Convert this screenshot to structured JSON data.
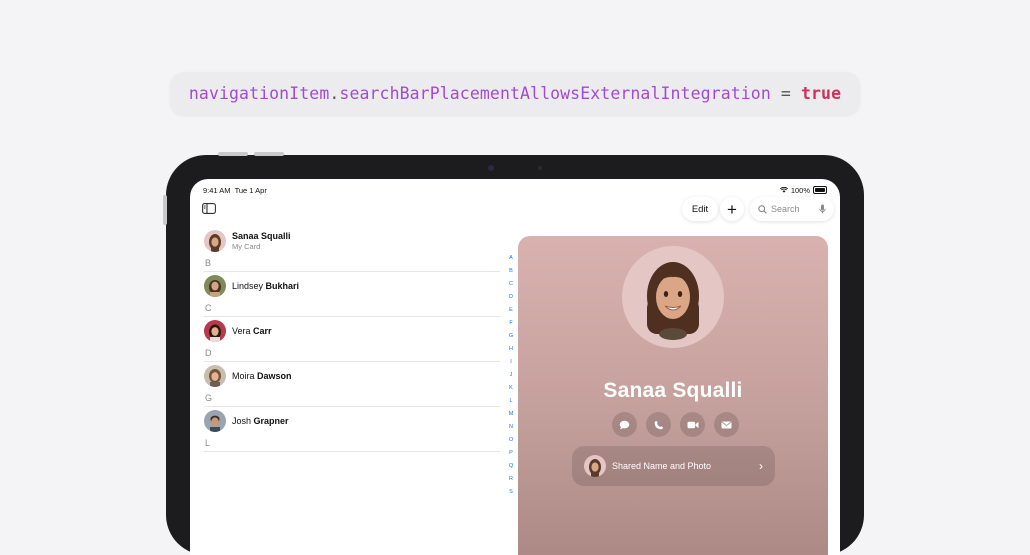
{
  "code": {
    "receiver": "navigationItem",
    "dot": ".",
    "property": "searchBarPlacementAllowsExternalIntegration",
    "operator": " = ",
    "value": "true"
  },
  "status": {
    "time": "9:41 AM",
    "date": "Tue 1 Apr",
    "battery": "100%"
  },
  "toolbar": {
    "edit_label": "Edit",
    "add_label": "+",
    "search_placeholder": "Search"
  },
  "my_card": {
    "first": "Sanaa Squalli",
    "subtitle": "My Card"
  },
  "sections": [
    {
      "header": "B",
      "first": "Lindsey ",
      "last": "Bukhari"
    },
    {
      "header": "C",
      "first": "Vera ",
      "last": "Carr"
    },
    {
      "header": "D",
      "first": "Moira ",
      "last": "Dawson"
    },
    {
      "header": "G",
      "first": "Josh ",
      "last": "Grapner"
    },
    {
      "header": "L"
    }
  ],
  "index_letters": [
    "A",
    "B",
    "C",
    "D",
    "E",
    "F",
    "G",
    "H",
    "I",
    "J",
    "K",
    "L",
    "M",
    "N",
    "O",
    "P",
    "Q",
    "R",
    "S"
  ],
  "detail": {
    "name": "Sanaa Squalli",
    "shared_label": "Shared Name and Photo"
  },
  "icons": {
    "sidebar": "sidebar-icon",
    "search": "search-icon",
    "mic": "mic-icon",
    "message": "message-icon",
    "phone": "phone-icon",
    "video": "video-icon",
    "mail": "mail-icon",
    "chevron": "chevron-right-icon"
  },
  "colors": {
    "code_purple": "#a24ad0",
    "code_red": "#d0305e",
    "index_blue": "#1a73e8",
    "card_top": "#d9b2b0"
  }
}
